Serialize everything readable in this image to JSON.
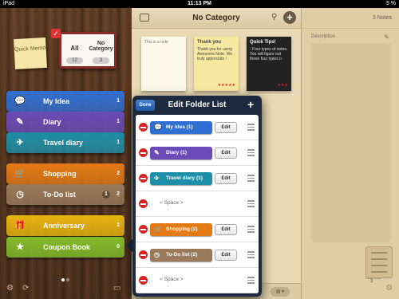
{
  "status": {
    "carrier": "iPad",
    "time": "11:13 PM",
    "battery": "5 %"
  },
  "sidebar": {
    "quick_memo": "Quick Memo",
    "book": {
      "all_label": "All",
      "all_count": "12",
      "nocat_label": "No Category",
      "nocat_count": "3"
    },
    "folders": [
      {
        "name": "My Idea",
        "badge": "1",
        "color": "#2f6fd4",
        "icon": "speech-bubble-icon"
      },
      {
        "name": "Diary",
        "badge": "1",
        "color": "#6a4bb8",
        "icon": "pencil-icon"
      },
      {
        "name": "Travel diary",
        "badge": "1",
        "color": "#1e8fa8",
        "icon": "airplane-icon"
      },
      {
        "name": "Shopping",
        "badge": "2",
        "color": "#e47a16",
        "icon": "cart-icon"
      },
      {
        "name": "To-Do list",
        "badge": "2",
        "badge2": "1",
        "color": "#9a7a5a",
        "icon": "clock-icon"
      },
      {
        "name": "Anniversary",
        "badge": "1",
        "color": "#e8b410",
        "icon": "gift-icon"
      },
      {
        "name": "Coupon Book",
        "badge": "0",
        "color": "#82bc2a",
        "icon": "star-icon"
      }
    ]
  },
  "middle": {
    "title": "No Category",
    "notes": [
      {
        "body": "This is a note"
      },
      {
        "title": "Thank you",
        "body": "Thank you for using Awesome Note. We truly appreciate !"
      },
      {
        "title": "Quick Tips!",
        "body": "- Four types of notes. You will figure out these four types o"
      }
    ]
  },
  "right": {
    "count": "3 Notes",
    "description_label": "Description",
    "normal_label": "Normal",
    "num": "3"
  },
  "popover": {
    "done_label": "Done",
    "title": "Edit Folder List",
    "rows": [
      {
        "label": "My Idea (1)",
        "color": "#2f6fd4",
        "edit": "Edit"
      },
      {
        "label": "Diary (1)",
        "color": "#6a4bb8",
        "edit": "Edit"
      },
      {
        "label": "Travel diary (1)",
        "color": "#1e8fa8",
        "edit": "Edit"
      },
      {
        "label": "< Space >"
      },
      {
        "label": "Shopping (2)",
        "color": "#e47a16",
        "edit": "Edit"
      },
      {
        "label": "To-Do list (2)",
        "color": "#9a7a5a",
        "edit": "Edit"
      },
      {
        "label": "< Space >"
      }
    ]
  }
}
